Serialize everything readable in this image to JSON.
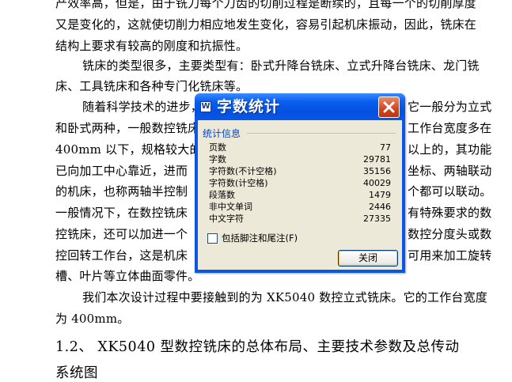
{
  "document": {
    "lines": [
      "产效率高，但是，由于铣刀每个刀齿的切削过程是断续的，且每一个的切削厚度",
      "又是变化的，这就使切削力相应地发生变化，容易引起机床振动，因此，铣床在",
      "结构上要求有较高的刚度和抗振性。",
      "铣床的类型很多，主要类型有：卧式升降台铣床、立式升降台铣床、龙门铣",
      "床、工具铣床和各种专门化铣床等。",
      "随着科学技术的进步，",
      "它一般分为立式",
      "和卧式两种，一般数控铣床",
      "工作台宽度多在",
      "400mm 以下，规格较大的",
      "以上的，其功能",
      "已向加工中心靠近，进而",
      "坐标、两轴联动",
      "的机床，也称两轴半控制",
      "个都可以联动。",
      "一般情况下，在数控铣床",
      "有特殊要求的数",
      "控铣床，还可以加进一个",
      "数控分度头或数",
      "控回转工作台，这是机床",
      "可用来加工旋转",
      "槽、叶片等立体曲面零件。",
      "我们本次设计过程中要接触到的为 XK5040 数控立式铣床。它的工作台宽度",
      "为 400mm。"
    ],
    "heading": "1.2、  XK5040 型数控铣床的总体布局、主要技术参数及总传动",
    "heading_cont": "系统图"
  },
  "dialog": {
    "title": "字数统计",
    "group_label": "统计信息",
    "stats": [
      {
        "label": "页数",
        "value": "77"
      },
      {
        "label": "字数",
        "value": "29781"
      },
      {
        "label": "字符数(不计空格)",
        "value": "35156"
      },
      {
        "label": "字符数(计空格)",
        "value": "40029"
      },
      {
        "label": "段落数",
        "value": "1479"
      },
      {
        "label": "非中文单词",
        "value": "2446"
      },
      {
        "label": "中文字符",
        "value": "27335"
      }
    ],
    "checkbox_label": "包括脚注和尾注(F)",
    "checkbox_checked": false,
    "close_button_label": "关闭"
  }
}
